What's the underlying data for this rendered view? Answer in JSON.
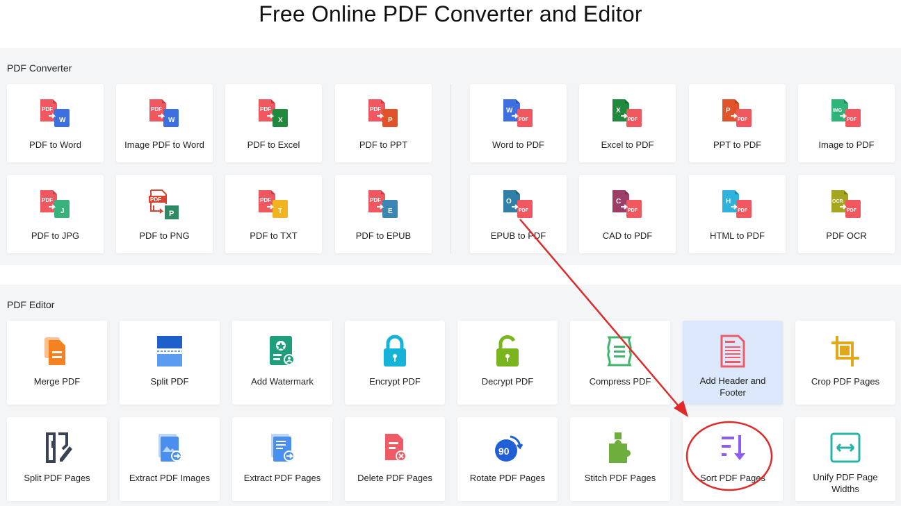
{
  "header": {
    "title": "Free Online PDF Converter and Editor"
  },
  "converter": {
    "title": "PDF Converter",
    "items": [
      {
        "label": "PDF to Word"
      },
      {
        "label": "Image PDF to Word"
      },
      {
        "label": "PDF to Excel"
      },
      {
        "label": "PDF to PPT"
      },
      {
        "label": "Word to PDF"
      },
      {
        "label": "Excel to PDF"
      },
      {
        "label": "PPT to PDF"
      },
      {
        "label": "Image to PDF"
      },
      {
        "label": "PDF to JPG"
      },
      {
        "label": "PDF to PNG"
      },
      {
        "label": "PDF to TXT"
      },
      {
        "label": "PDF to EPUB"
      },
      {
        "label": "EPUB to PDF"
      },
      {
        "label": "CAD to PDF"
      },
      {
        "label": "HTML to PDF"
      },
      {
        "label": "PDF OCR"
      }
    ]
  },
  "editor": {
    "title": "PDF Editor",
    "items": [
      {
        "label": "Merge PDF"
      },
      {
        "label": "Split PDF"
      },
      {
        "label": "Add Watermark"
      },
      {
        "label": "Encrypt PDF"
      },
      {
        "label": "Decrypt PDF"
      },
      {
        "label": "Compress PDF"
      },
      {
        "label": "Add Header and Footer"
      },
      {
        "label": "Crop PDF Pages"
      },
      {
        "label": "Split PDF Pages"
      },
      {
        "label": "Extract PDF Images"
      },
      {
        "label": "Extract PDF Pages"
      },
      {
        "label": "Delete PDF Pages"
      },
      {
        "label": "Rotate PDF Pages"
      },
      {
        "label": "Stitch PDF Pages"
      },
      {
        "label": "Sort PDF Pages"
      },
      {
        "label": "Unify PDF Page Widths"
      }
    ]
  },
  "icon_text": {
    "pdf": "PDF",
    "w": "W",
    "x": "X",
    "p": "P",
    "img": "IMG",
    "j": "J",
    "t": "T",
    "e": "E",
    "o": "O",
    "c": "C",
    "h": "H",
    "ocr": "OCR",
    "ninety": "90"
  },
  "colors": {
    "pdf_red": "#f0575f",
    "word_blue": "#3e6fe0",
    "excel_green": "#1f8a3c",
    "ppt_orange": "#e0532a",
    "highlight": "#dbe8fb",
    "annotation_red": "#e02a2a"
  }
}
